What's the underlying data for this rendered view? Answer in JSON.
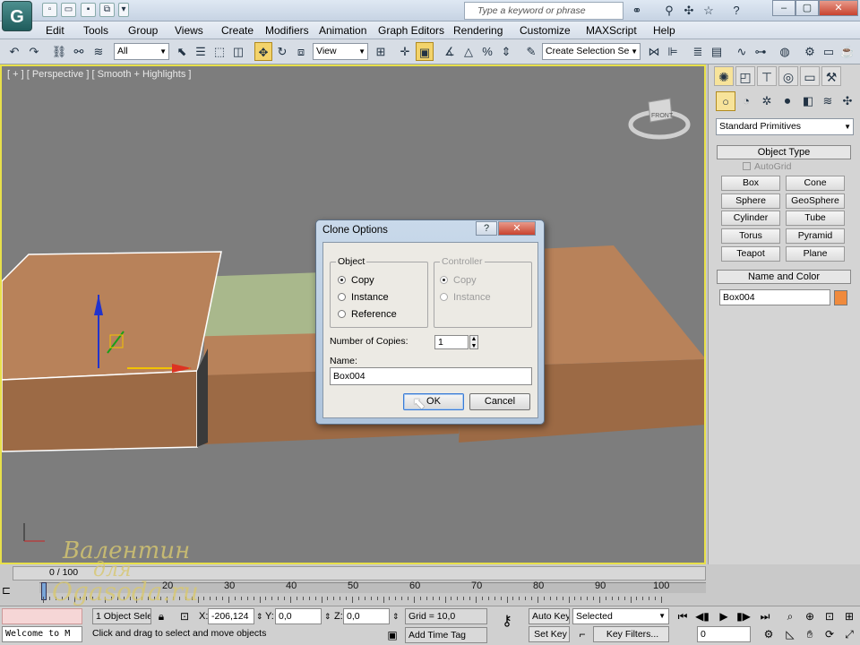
{
  "search_placeholder": "Type a keyword or phrase",
  "menu": [
    "Edit",
    "Tools",
    "Group",
    "Views",
    "Create",
    "Modifiers",
    "Animation",
    "Graph Editors",
    "Rendering",
    "Customize",
    "MAXScript",
    "Help"
  ],
  "toolbar": {
    "filter": "All",
    "refcoord": "View",
    "selset": "Create Selection Se"
  },
  "viewport": {
    "label": "[ + ] [ Perspective ] [ Smooth + Highlights ]",
    "viewcube": "FRONT"
  },
  "panel": {
    "category": "Standard Primitives",
    "object_type": "Object Type",
    "autogrid": "AutoGrid",
    "buttons": [
      "Box",
      "Cone",
      "Sphere",
      "GeoSphere",
      "Cylinder",
      "Tube",
      "Torus",
      "Pyramid",
      "Teapot",
      "Plane"
    ],
    "name_color": "Name and Color",
    "name_value": "Box004",
    "obj_color": "#f08a3c"
  },
  "dialog": {
    "title": "Clone Options",
    "object_group": "Object",
    "object_opts": [
      "Copy",
      "Instance",
      "Reference"
    ],
    "controller_group": "Controller",
    "controller_opts": [
      "Copy",
      "Instance"
    ],
    "copies_label": "Number of Copies:",
    "copies_value": "1",
    "name_label": "Name:",
    "name_value": "Box004",
    "ok": "OK",
    "cancel": "Cancel"
  },
  "timeline": {
    "frame": "0 / 100",
    "ticks": [
      "20",
      "30",
      "40",
      "50",
      "60",
      "70",
      "80",
      "90",
      "100"
    ]
  },
  "status": {
    "maxscript": "Welcome to M",
    "selected": "1 Object Sele",
    "prompt": "Click and drag to select and move objects",
    "x_label": "X:",
    "x": "-206,124",
    "y_label": "Y:",
    "y": "0,0",
    "z_label": "Z:",
    "z": "0,0",
    "grid": "Grid = 10,0",
    "add_time_tag": "Add Time Tag",
    "auto_key": "Auto Key",
    "set_key": "Set Key",
    "key_mode": "Selected",
    "key_filters": "Key Filters...",
    "frame_value": "0"
  },
  "watermark": [
    "Валентин",
    "для",
    "Ogasoda.ru"
  ]
}
